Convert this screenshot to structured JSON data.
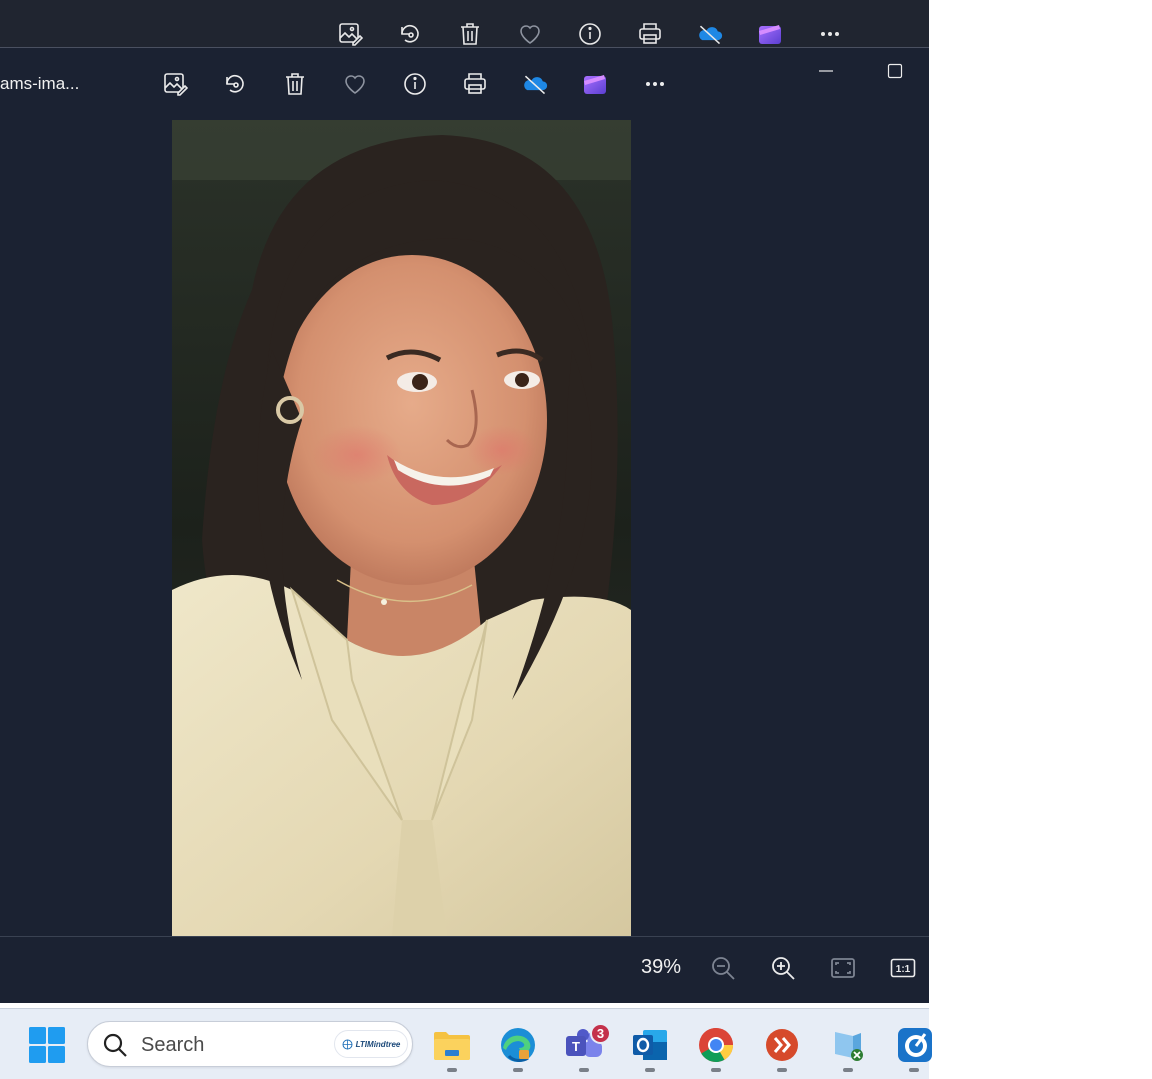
{
  "window": {
    "filename": "ams-ima...",
    "toolbar": [
      {
        "name": "edit-image-icon"
      },
      {
        "name": "rotate-icon"
      },
      {
        "name": "delete-icon"
      },
      {
        "name": "favorite-heart-icon"
      },
      {
        "name": "info-icon"
      },
      {
        "name": "print-icon"
      },
      {
        "name": "onedrive-offline-icon"
      },
      {
        "name": "clipchamp-icon"
      },
      {
        "name": "more-options-icon"
      }
    ]
  },
  "photo": {
    "description_icon": "portrait-photo"
  },
  "bottom_bar": {
    "zoom": "39%",
    "actual_size_label": "1:1"
  },
  "taskbar": {
    "search_placeholder": "Search",
    "brand": "LTIMindtree",
    "teams_badge": "3",
    "apps": [
      {
        "name": "file-explorer-icon"
      },
      {
        "name": "edge-icon"
      },
      {
        "name": "teams-icon"
      },
      {
        "name": "outlook-icon"
      },
      {
        "name": "chrome-icon"
      },
      {
        "name": "remote-desktop-icon"
      },
      {
        "name": "network-app-icon"
      },
      {
        "name": "blue-app-icon"
      }
    ]
  },
  "colors": {
    "window_bg": "#1b2232",
    "taskbar_bg": "#e7edf6",
    "accent": "#0078d4"
  }
}
